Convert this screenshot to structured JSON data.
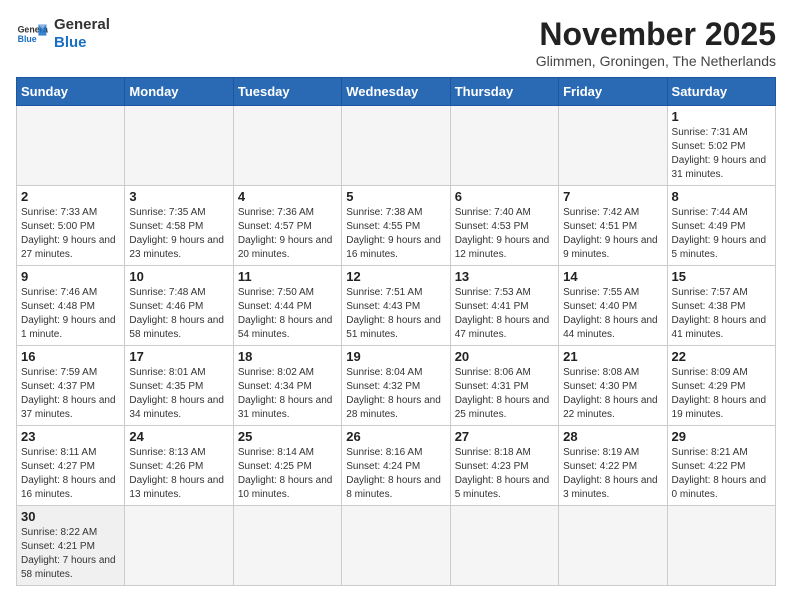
{
  "header": {
    "logo_general": "General",
    "logo_blue": "Blue",
    "month_title": "November 2025",
    "location": "Glimmen, Groningen, The Netherlands"
  },
  "days_of_week": [
    "Sunday",
    "Monday",
    "Tuesday",
    "Wednesday",
    "Thursday",
    "Friday",
    "Saturday"
  ],
  "weeks": [
    [
      {
        "day": "",
        "info": ""
      },
      {
        "day": "",
        "info": ""
      },
      {
        "day": "",
        "info": ""
      },
      {
        "day": "",
        "info": ""
      },
      {
        "day": "",
        "info": ""
      },
      {
        "day": "",
        "info": ""
      },
      {
        "day": "1",
        "info": "Sunrise: 7:31 AM\nSunset: 5:02 PM\nDaylight: 9 hours and 31 minutes."
      }
    ],
    [
      {
        "day": "2",
        "info": "Sunrise: 7:33 AM\nSunset: 5:00 PM\nDaylight: 9 hours and 27 minutes."
      },
      {
        "day": "3",
        "info": "Sunrise: 7:35 AM\nSunset: 4:58 PM\nDaylight: 9 hours and 23 minutes."
      },
      {
        "day": "4",
        "info": "Sunrise: 7:36 AM\nSunset: 4:57 PM\nDaylight: 9 hours and 20 minutes."
      },
      {
        "day": "5",
        "info": "Sunrise: 7:38 AM\nSunset: 4:55 PM\nDaylight: 9 hours and 16 minutes."
      },
      {
        "day": "6",
        "info": "Sunrise: 7:40 AM\nSunset: 4:53 PM\nDaylight: 9 hours and 12 minutes."
      },
      {
        "day": "7",
        "info": "Sunrise: 7:42 AM\nSunset: 4:51 PM\nDaylight: 9 hours and 9 minutes."
      },
      {
        "day": "8",
        "info": "Sunrise: 7:44 AM\nSunset: 4:49 PM\nDaylight: 9 hours and 5 minutes."
      }
    ],
    [
      {
        "day": "9",
        "info": "Sunrise: 7:46 AM\nSunset: 4:48 PM\nDaylight: 9 hours and 1 minute."
      },
      {
        "day": "10",
        "info": "Sunrise: 7:48 AM\nSunset: 4:46 PM\nDaylight: 8 hours and 58 minutes."
      },
      {
        "day": "11",
        "info": "Sunrise: 7:50 AM\nSunset: 4:44 PM\nDaylight: 8 hours and 54 minutes."
      },
      {
        "day": "12",
        "info": "Sunrise: 7:51 AM\nSunset: 4:43 PM\nDaylight: 8 hours and 51 minutes."
      },
      {
        "day": "13",
        "info": "Sunrise: 7:53 AM\nSunset: 4:41 PM\nDaylight: 8 hours and 47 minutes."
      },
      {
        "day": "14",
        "info": "Sunrise: 7:55 AM\nSunset: 4:40 PM\nDaylight: 8 hours and 44 minutes."
      },
      {
        "day": "15",
        "info": "Sunrise: 7:57 AM\nSunset: 4:38 PM\nDaylight: 8 hours and 41 minutes."
      }
    ],
    [
      {
        "day": "16",
        "info": "Sunrise: 7:59 AM\nSunset: 4:37 PM\nDaylight: 8 hours and 37 minutes."
      },
      {
        "day": "17",
        "info": "Sunrise: 8:01 AM\nSunset: 4:35 PM\nDaylight: 8 hours and 34 minutes."
      },
      {
        "day": "18",
        "info": "Sunrise: 8:02 AM\nSunset: 4:34 PM\nDaylight: 8 hours and 31 minutes."
      },
      {
        "day": "19",
        "info": "Sunrise: 8:04 AM\nSunset: 4:32 PM\nDaylight: 8 hours and 28 minutes."
      },
      {
        "day": "20",
        "info": "Sunrise: 8:06 AM\nSunset: 4:31 PM\nDaylight: 8 hours and 25 minutes."
      },
      {
        "day": "21",
        "info": "Sunrise: 8:08 AM\nSunset: 4:30 PM\nDaylight: 8 hours and 22 minutes."
      },
      {
        "day": "22",
        "info": "Sunrise: 8:09 AM\nSunset: 4:29 PM\nDaylight: 8 hours and 19 minutes."
      }
    ],
    [
      {
        "day": "23",
        "info": "Sunrise: 8:11 AM\nSunset: 4:27 PM\nDaylight: 8 hours and 16 minutes."
      },
      {
        "day": "24",
        "info": "Sunrise: 8:13 AM\nSunset: 4:26 PM\nDaylight: 8 hours and 13 minutes."
      },
      {
        "day": "25",
        "info": "Sunrise: 8:14 AM\nSunset: 4:25 PM\nDaylight: 8 hours and 10 minutes."
      },
      {
        "day": "26",
        "info": "Sunrise: 8:16 AM\nSunset: 4:24 PM\nDaylight: 8 hours and 8 minutes."
      },
      {
        "day": "27",
        "info": "Sunrise: 8:18 AM\nSunset: 4:23 PM\nDaylight: 8 hours and 5 minutes."
      },
      {
        "day": "28",
        "info": "Sunrise: 8:19 AM\nSunset: 4:22 PM\nDaylight: 8 hours and 3 minutes."
      },
      {
        "day": "29",
        "info": "Sunrise: 8:21 AM\nSunset: 4:22 PM\nDaylight: 8 hours and 0 minutes."
      }
    ],
    [
      {
        "day": "30",
        "info": "Sunrise: 8:22 AM\nSunset: 4:21 PM\nDaylight: 7 hours and 58 minutes."
      },
      {
        "day": "",
        "info": ""
      },
      {
        "day": "",
        "info": ""
      },
      {
        "day": "",
        "info": ""
      },
      {
        "day": "",
        "info": ""
      },
      {
        "day": "",
        "info": ""
      },
      {
        "day": "",
        "info": ""
      }
    ]
  ]
}
